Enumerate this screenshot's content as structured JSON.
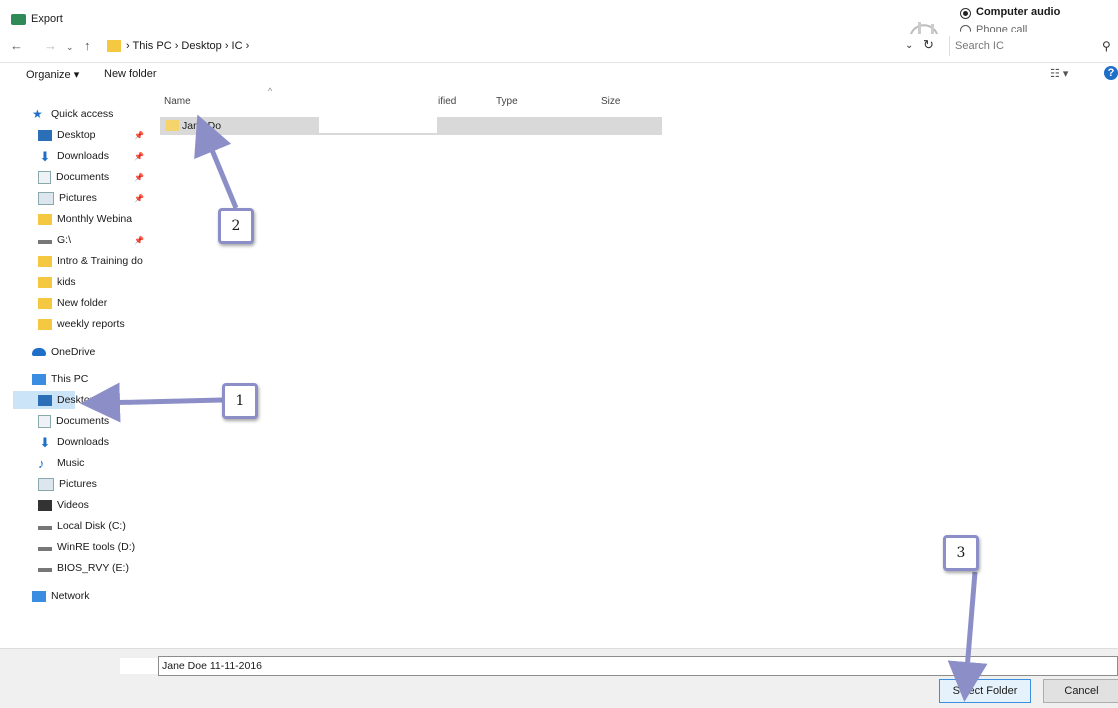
{
  "window": {
    "title": "Export"
  },
  "audio": {
    "computer_audio": "Computer audio",
    "phone_call": "Phone call"
  },
  "address": {
    "crumbs": "› This PC › Desktop › IC ›",
    "search_placeholder": "Search IC"
  },
  "toolbar": {
    "organize": "Organize ▾",
    "new_folder": "New folder",
    "view": "☷ ▾",
    "help": "?"
  },
  "nav": {
    "quick_access": "Quick access",
    "items": [
      "Desktop",
      "Downloads",
      "Documents",
      "Pictures",
      "Monthly Webina",
      "G:\\",
      "Intro & Training do",
      "kids",
      "New folder",
      "weekly reports"
    ],
    "onedrive": "OneDrive",
    "this_pc": "This PC",
    "pc_items": [
      "Desktop",
      "Documents",
      "Downloads",
      "Music",
      "Pictures",
      "Videos",
      "Local Disk (C:)",
      "WinRE tools (D:)",
      "BIOS_RVY (E:)"
    ],
    "network": "Network"
  },
  "columns": {
    "name": "Name",
    "modified": "ified",
    "type": "Type",
    "size": "Size"
  },
  "files": [
    {
      "name": "Jane Do"
    }
  ],
  "filename": {
    "value": "Jane Doe 11-11-2016"
  },
  "buttons": {
    "select": "Select Folder",
    "cancel": "Cancel"
  },
  "callouts": [
    "1",
    "2",
    "3"
  ],
  "colors": {
    "accent": "#1e6fc8",
    "callout_border": "#8c8fc7",
    "selected": "#cce4f7"
  }
}
